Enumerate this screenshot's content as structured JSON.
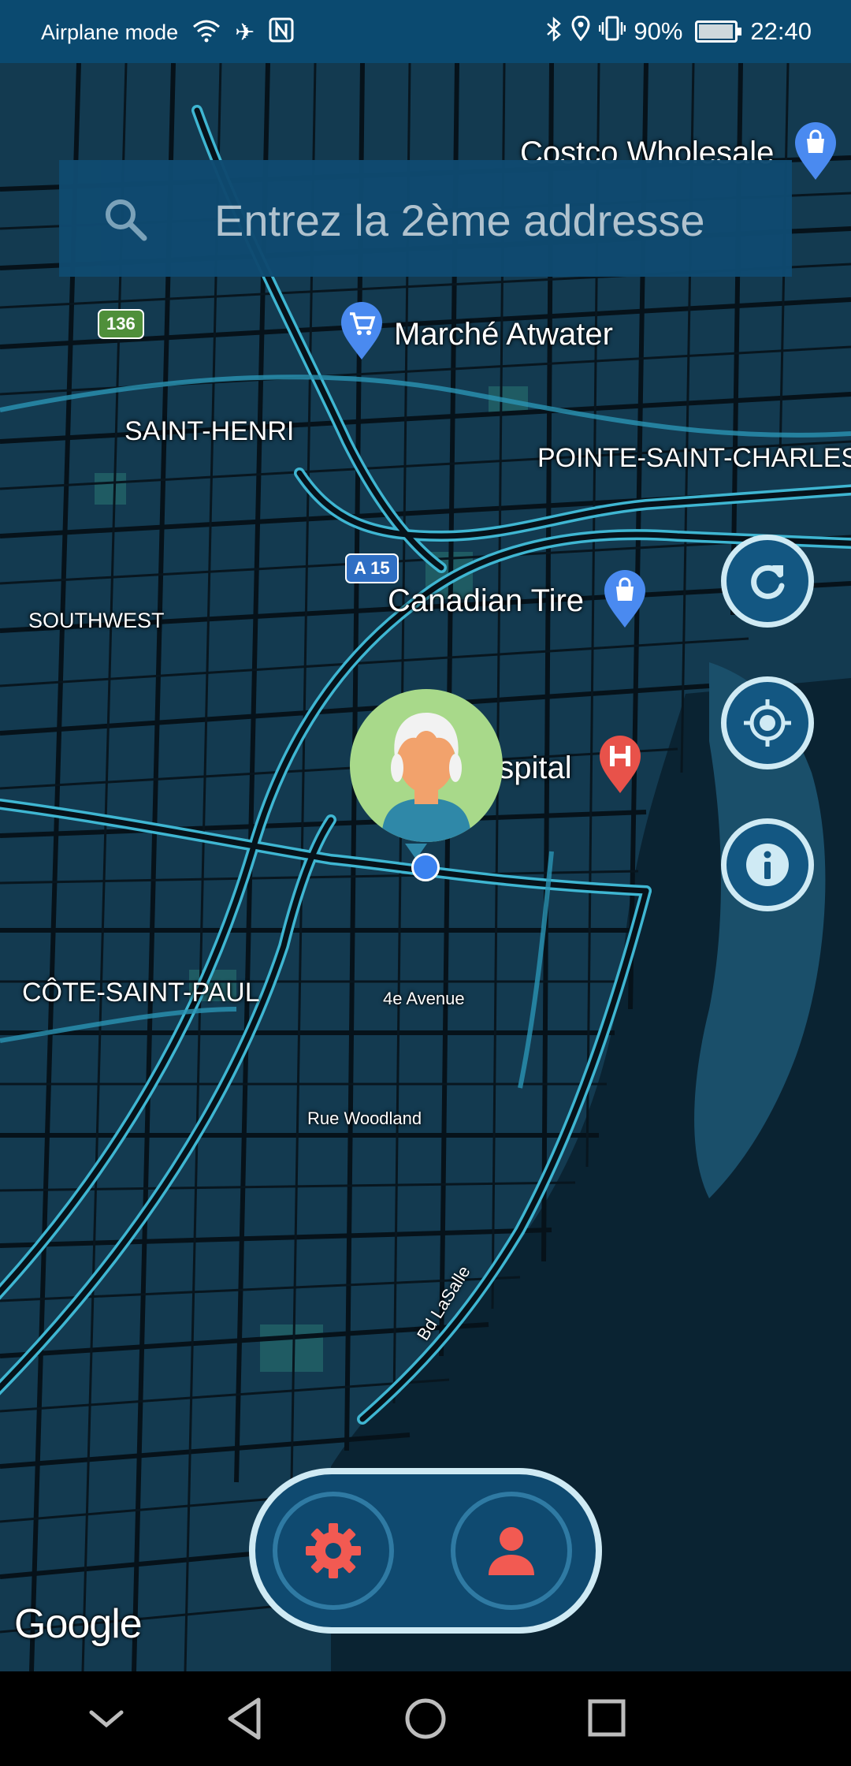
{
  "status_bar": {
    "carrier": "Airplane mode",
    "battery": "90%",
    "time": "22:40",
    "icons_left": [
      "wifi-icon",
      "airplane-icon",
      "nfc-icon"
    ],
    "icons_right": [
      "bluetooth-icon",
      "location-icon",
      "vibrate-icon",
      "battery-icon"
    ]
  },
  "search": {
    "placeholder": "Entrez la 2ème addresse",
    "icon": "search-icon"
  },
  "map": {
    "labels": {
      "costco": "Costco Wholesale",
      "marche": "Marché Atwater",
      "saint_henri": "SAINT-HENRI",
      "pointe": "POINTE-SAINT-CHARLES",
      "southwest": "SOUTHWEST",
      "canadian_tire": "Canadian Tire",
      "hospital": "ospital",
      "cote": "CÔTE-SAINT-PAUL",
      "avenue": "4e Avenue",
      "woodland": "Rue Woodland",
      "lasalle": "Bd LaSalle"
    },
    "shields": {
      "route136": "136",
      "a15": "A 15"
    },
    "attribution": "Google"
  },
  "side_buttons": {
    "refresh": "refresh-icon",
    "locate": "crosshair-icon",
    "info": "info-icon"
  },
  "bottom_bar": {
    "settings": "gear-icon",
    "profile": "person-icon"
  },
  "colors": {
    "accent": "#0f4a70",
    "ring": "#cfeaf4",
    "action_icon": "#f25a52",
    "road": "#3fb6d2"
  }
}
